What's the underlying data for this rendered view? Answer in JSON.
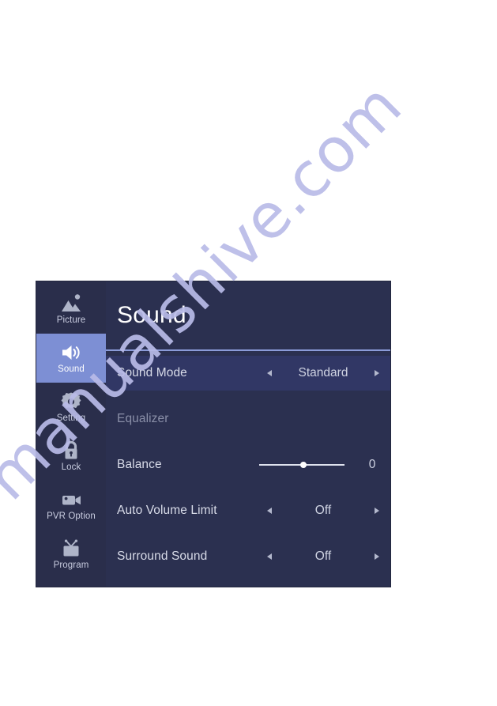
{
  "panel": {
    "title": "Sound",
    "accent_color": "#7d8fd4",
    "background_color": "#2a2f4e",
    "divider_color": "#8b9bd8"
  },
  "sidebar": {
    "items": [
      {
        "label": "Picture",
        "icon": "picture-icon",
        "active": false
      },
      {
        "label": "Sound",
        "icon": "sound-icon",
        "active": true
      },
      {
        "label": "Setting",
        "icon": "gear-icon",
        "active": false
      },
      {
        "label": "Lock",
        "icon": "lock-icon",
        "active": false
      },
      {
        "label": "PVR Option",
        "icon": "camcorder-icon",
        "active": false
      },
      {
        "label": "Program",
        "icon": "tv-icon",
        "active": false
      }
    ]
  },
  "rows": [
    {
      "label": "Sound Mode",
      "type": "stepper",
      "value": "Standard",
      "left_arrow": "◄",
      "right_arrow": "►",
      "highlighted": true,
      "disabled": false
    },
    {
      "label": "Equalizer",
      "type": "submenu",
      "value": "",
      "highlighted": false,
      "disabled": true
    },
    {
      "label": "Balance",
      "type": "slider",
      "value": "0",
      "slider_percent": 50,
      "highlighted": false,
      "disabled": false
    },
    {
      "label": "Auto Volume Limit",
      "type": "stepper",
      "value": "Off",
      "left_arrow": "◄",
      "right_arrow": "►",
      "highlighted": false,
      "disabled": false
    },
    {
      "label": "Surround Sound",
      "type": "stepper",
      "value": "Off",
      "left_arrow": "◄",
      "right_arrow": "►",
      "highlighted": false,
      "disabled": false
    }
  ],
  "watermark": {
    "text": "manualshive.com",
    "color": "#b9bbe8"
  }
}
